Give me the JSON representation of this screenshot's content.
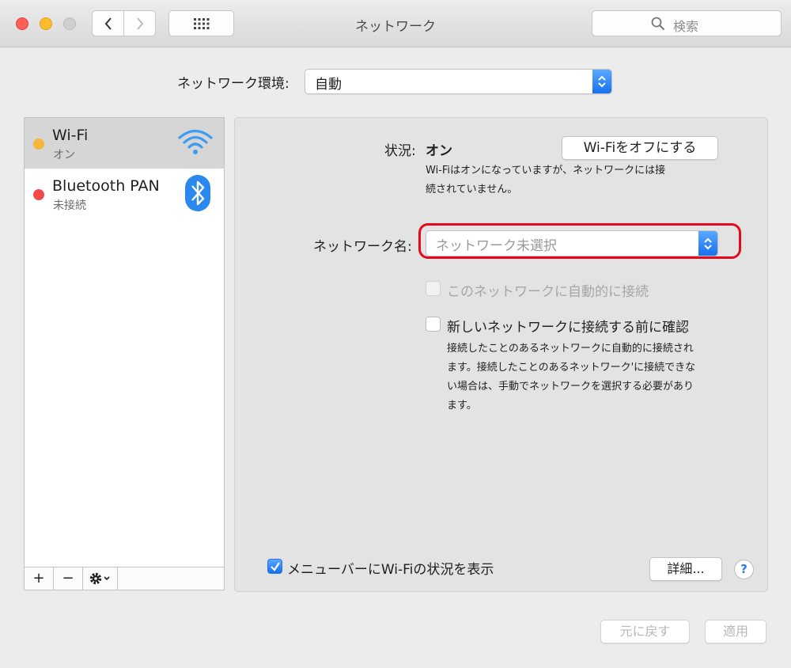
{
  "window": {
    "title": "ネットワーク"
  },
  "titlebar": {
    "search_placeholder": "検索"
  },
  "location": {
    "label": "ネットワーク環境:",
    "value": "自動"
  },
  "services": [
    {
      "name": "Wi-Fi",
      "status": "オン",
      "status_color": "#f5b63d",
      "icon": "wifi-icon",
      "selected": true
    },
    {
      "name": "Bluetooth PAN",
      "status": "未接続",
      "status_color": "#f24a4a",
      "icon": "bluetooth-icon",
      "selected": false
    }
  ],
  "sidebar_toolbar": {
    "add": "+",
    "remove": "−"
  },
  "status": {
    "label": "状況:",
    "value": "オン",
    "description_line1": "Wi-Fiはオンになっていますが、ネットワークには接",
    "description_line2": "続されていません。",
    "toggle_button": "Wi-Fiをオフにする"
  },
  "network_name": {
    "label": "ネットワーク名:",
    "placeholder": "ネットワーク未選択"
  },
  "options": {
    "auto_join": {
      "label": "このネットワークに自動的に接続",
      "checked": false,
      "enabled": false
    },
    "ask_to_join": {
      "label": "新しいネットワークに接続する前に確認",
      "checked": false,
      "enabled": true
    },
    "ask_description_line1": "接続したことのあるネットワークに自動的に接続され",
    "ask_description_line2": "ます。接続したことのあるネットワーク'に接続できな",
    "ask_description_line3": "い場合は、手動でネットワークを選択する必要があり",
    "ask_description_line4": "ます。"
  },
  "menubar_option": {
    "label": "メニューバーにWi-Fiの状況を表示",
    "checked": true
  },
  "buttons": {
    "advanced": "詳細...",
    "help": "?",
    "revert": "元に戻す",
    "apply": "適用"
  },
  "colors": {
    "accent": "#1870ee",
    "highlight": "#e5091b"
  }
}
